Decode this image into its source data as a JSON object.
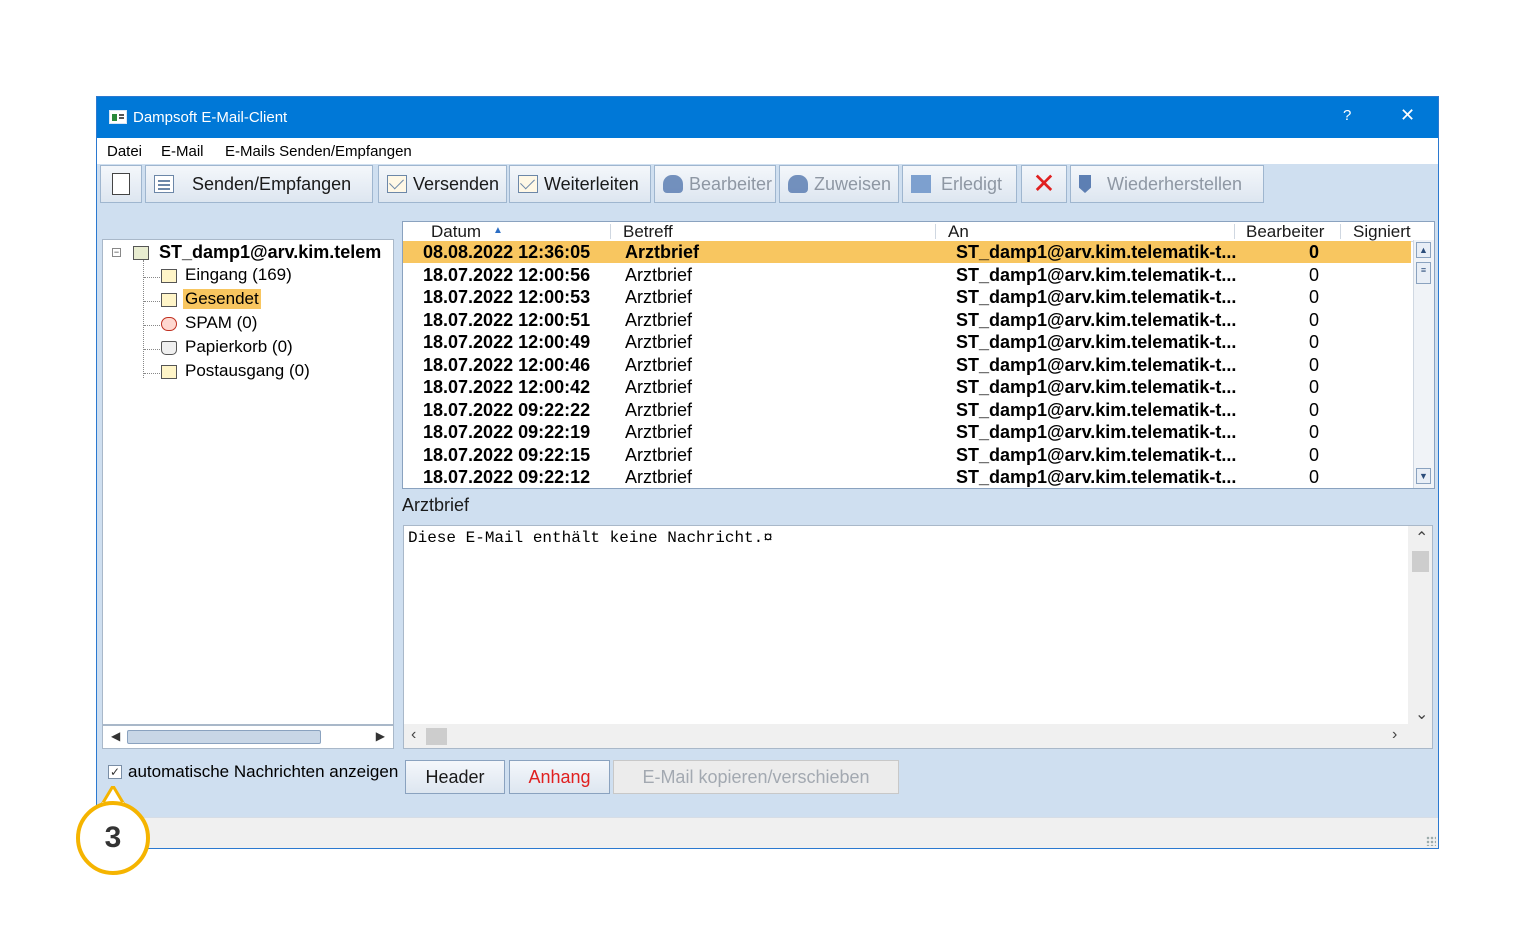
{
  "window": {
    "title": "Dampsoft E-Mail-Client",
    "help": "?",
    "close": "✕"
  },
  "menu": [
    "Datei",
    "E-Mail",
    "E-Mails Senden/Empfangen"
  ],
  "toolbar": {
    "send_receive": "Senden/Empfangen",
    "send": "Versenden",
    "forward": "Weiterleiten",
    "edit": "Bearbeiter",
    "assign": "Zuweisen",
    "done": "Erledigt",
    "restore": "Wiederherstellen"
  },
  "tree": {
    "root": "ST_damp1@arv.kim.telem",
    "folders": [
      "Eingang (169)",
      "Gesendet",
      "SPAM (0)",
      "Papierkorb (0)",
      "Postausgang (0)"
    ],
    "selected_index": 1
  },
  "mail_list": {
    "columns": [
      "Datum",
      "Betreff",
      "An",
      "Bearbeiter",
      "Signiert"
    ],
    "rows": [
      {
        "date": "08.08.2022 12:36:05",
        "subject": "Arztbrief",
        "to": "ST_damp1@arv.kim.telematik-t...",
        "processor": "0"
      },
      {
        "date": "18.07.2022 12:00:56",
        "subject": "Arztbrief",
        "to": "ST_damp1@arv.kim.telematik-t...",
        "processor": "0"
      },
      {
        "date": "18.07.2022 12:00:53",
        "subject": "Arztbrief",
        "to": "ST_damp1@arv.kim.telematik-t...",
        "processor": "0"
      },
      {
        "date": "18.07.2022 12:00:51",
        "subject": "Arztbrief",
        "to": "ST_damp1@arv.kim.telematik-t...",
        "processor": "0"
      },
      {
        "date": "18.07.2022 12:00:49",
        "subject": "Arztbrief",
        "to": "ST_damp1@arv.kim.telematik-t...",
        "processor": "0"
      },
      {
        "date": "18.07.2022 12:00:46",
        "subject": "Arztbrief",
        "to": "ST_damp1@arv.kim.telematik-t...",
        "processor": "0"
      },
      {
        "date": "18.07.2022 12:00:42",
        "subject": "Arztbrief",
        "to": "ST_damp1@arv.kim.telematik-t...",
        "processor": "0"
      },
      {
        "date": "18.07.2022 09:22:22",
        "subject": "Arztbrief",
        "to": "ST_damp1@arv.kim.telematik-t...",
        "processor": "0"
      },
      {
        "date": "18.07.2022 09:22:19",
        "subject": "Arztbrief",
        "to": "ST_damp1@arv.kim.telematik-t...",
        "processor": "0"
      },
      {
        "date": "18.07.2022 09:22:15",
        "subject": "Arztbrief",
        "to": "ST_damp1@arv.kim.telematik-t...",
        "processor": "0"
      },
      {
        "date": "18.07.2022 09:22:12",
        "subject": "Arztbrief",
        "to": "ST_damp1@arv.kim.telematik-t...",
        "processor": "0"
      }
    ],
    "selected_index": 0
  },
  "preview": {
    "subject": "Arztbrief",
    "body": "Diese E-Mail enthält keine Nachricht.¤"
  },
  "bottom": {
    "auto_messages_label": "automatische Nachrichten anzeigen",
    "auto_messages_checked": true,
    "header_button": "Header",
    "attachment_button": "Anhang",
    "copy_move_button": "E-Mail kopieren/verschieben"
  },
  "callout": {
    "number": "3"
  },
  "colors": {
    "titlebar": "#0078d7",
    "selection": "#f8c660",
    "callout": "#f5b400",
    "delete": "#e02020"
  }
}
